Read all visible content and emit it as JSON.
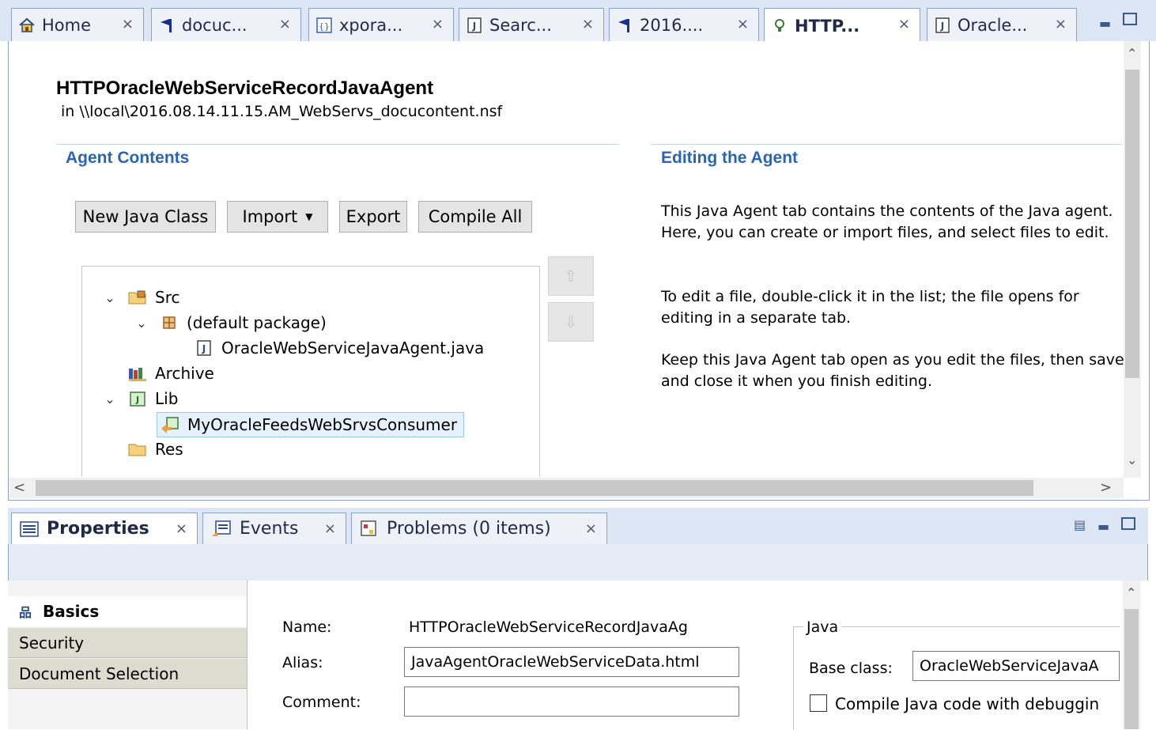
{
  "editor_tabs": [
    {
      "label": "Home",
      "icon": "home-icon",
      "active": false
    },
    {
      "label": "docuc...",
      "icon": "flag-icon",
      "active": false
    },
    {
      "label": "xpora...",
      "icon": "xpages-icon",
      "active": false
    },
    {
      "label": "Searc...",
      "icon": "java-file-icon",
      "active": false
    },
    {
      "label": "2016....",
      "icon": "flag-icon",
      "active": false
    },
    {
      "label": "HTTP...",
      "icon": "agent-bulb-icon",
      "active": true
    },
    {
      "label": "Oracle...",
      "icon": "java-file-icon",
      "active": false
    }
  ],
  "close_glyph": "×",
  "agent": {
    "title": "HTTPOracleWebServiceRecordJavaAgent",
    "location": "in \\\\local\\2016.08.14.11.15.AM_WebServs_docucontent.nsf"
  },
  "agent_contents": {
    "heading": "Agent Contents",
    "buttons": {
      "new_java_class": "New Java Class",
      "import": "Import",
      "export": "Export",
      "compile_all": "Compile All"
    },
    "tree": {
      "src": "Src",
      "default_package": "(default package)",
      "java_file": "OracleWebServiceJavaAgent.java",
      "archive": "Archive",
      "lib": "Lib",
      "lib_item": "MyOracleFeedsWebSrvsConsumer",
      "res": "Res"
    }
  },
  "editing_help": {
    "heading": "Editing the Agent",
    "p1": "This Java Agent tab contains the contents of the Java agent. Here, you can create or import files, and select files to edit.",
    "p2": "To edit a file, double-click it in the list; the file opens for editing in a separate tab.",
    "p3": "Keep this Java Agent tab open as you edit the files, then save and close it when you finish editing."
  },
  "view_tabs": [
    {
      "label": "Properties",
      "icon": "properties-icon",
      "active": true
    },
    {
      "label": "Events",
      "icon": "events-icon",
      "active": false
    },
    {
      "label": "Problems (0 items)",
      "icon": "problems-icon",
      "active": false
    }
  ],
  "properties": {
    "sidebar": [
      "Basics",
      "Security",
      "Document Selection"
    ],
    "name_label": "Name:",
    "name_value": "HTTPOracleWebServiceRecordJavaAg",
    "alias_label": "Alias:",
    "alias_value": "JavaAgentOracleWebServiceData.html",
    "comment_label": "Comment:",
    "comment_value": "",
    "java_group": "Java",
    "base_class_label": "Base class:",
    "base_class_value": "OracleWebServiceJavaA",
    "debug_label": "Compile Java code with debuggin",
    "debug_checked": false
  }
}
